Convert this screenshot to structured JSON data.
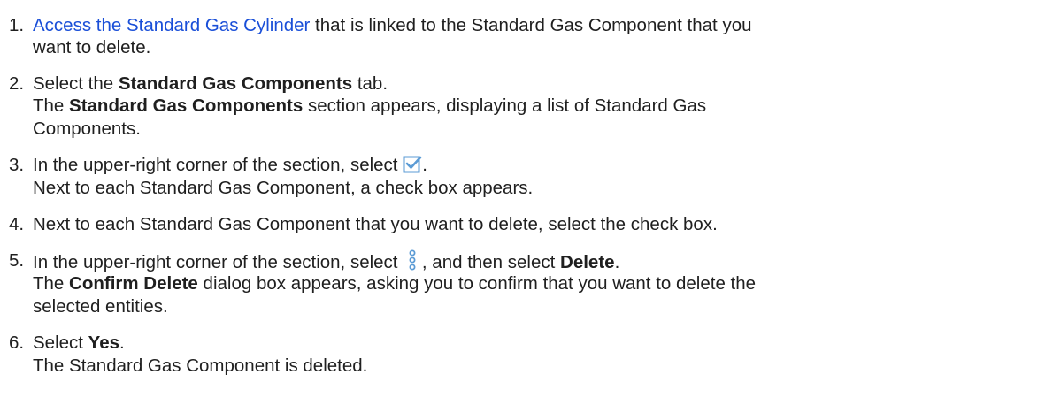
{
  "steps": [
    {
      "number": "1.",
      "link_text": "Access the Standard Gas Cylinder",
      "text_after_link": " that is linked to the Standard Gas Component that you",
      "line2": "want to delete."
    },
    {
      "number": "2.",
      "text_before": "Select the ",
      "bold": "Standard Gas Components",
      "text_after": " tab.",
      "result_before": "The ",
      "result_bold": "Standard Gas Components",
      "result_after": " section appears, displaying a list of Standard Gas",
      "result_line2": "Components."
    },
    {
      "number": "3.",
      "text_before": "In the upper-right corner of the section, select ",
      "icon": "select-checkbox-icon",
      "text_after": ".",
      "result": "Next to each Standard Gas Component, a check box appears."
    },
    {
      "number": "4.",
      "text": "Next to each Standard Gas Component that you want to delete, select the check box."
    },
    {
      "number": "5.",
      "text_before": "In the upper-right corner of the section, select ",
      "icon": "more-options-icon",
      "text_middle": " , and then select ",
      "bold": "Delete",
      "text_after": ".",
      "result_before": "The ",
      "result_bold": "Confirm Delete",
      "result_after": " dialog box appears, asking you to confirm that you want to delete the",
      "result_line2": "selected entities."
    },
    {
      "number": "6.",
      "text_before": "Select ",
      "bold": "Yes",
      "text_after": ".",
      "result": "The Standard Gas Component is deleted."
    }
  ],
  "colors": {
    "link": "#1a4fd8",
    "text": "#1f1f1f",
    "checkbox_icon": "#5b9bd5"
  }
}
